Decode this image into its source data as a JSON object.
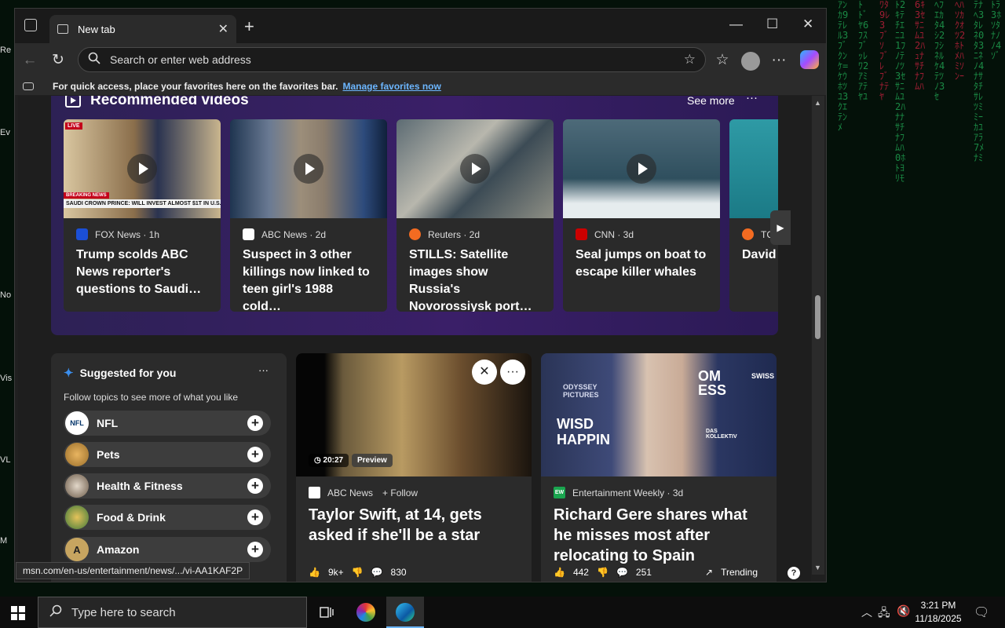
{
  "browser": {
    "tab_title": "New tab",
    "address_placeholder": "Search or enter web address",
    "favbar_text": "For quick access, place your favorites here on the favorites bar.",
    "favbar_link": "Manage favorites now",
    "status_url": "msn.com/en-us/entertainment/news/.../vi-AA1KAF2P"
  },
  "videos": {
    "title": "Recommended videos",
    "see_more": "See more",
    "more": "···",
    "items": [
      {
        "source": "FOX News · 1h",
        "headline": "Trump scolds ABC News reporter's questions to Saudi…",
        "logo_color": "#1b4fd6"
      },
      {
        "source": "ABC News · 2d",
        "headline": "Suspect in 3 other killings now linked to teen girl's 1988 cold…",
        "logo_color": "#ffffff"
      },
      {
        "source": "Reuters · 2d",
        "headline": "STILLS: Satellite images show Russia's Novorossiysk port…",
        "logo_color": "#f36b21"
      },
      {
        "source": "CNN · 3d",
        "headline": "Seal jumps on boat to escape killer whales",
        "logo_color": "#cc0000"
      },
      {
        "source": "TC",
        "headline": "David Why 'I Canno",
        "logo_color": "#f36b21"
      }
    ],
    "thumb_text": {
      "breaking": "BREAKING NEWS",
      "live": "LIVE",
      "ticker": "SAUDI CROWN PRINCE: WILL INVEST ALMOST $1T IN U.S."
    }
  },
  "suggested": {
    "title": "Suggested for you",
    "subtitle": "Follow topics to see more of what you like",
    "more": "···",
    "topics": [
      {
        "label": "NFL",
        "icon": "NFL"
      },
      {
        "label": "Pets",
        "icon": ""
      },
      {
        "label": "Health & Fitness",
        "icon": ""
      },
      {
        "label": "Food & Drink",
        "icon": ""
      },
      {
        "label": "Amazon",
        "icon": "A"
      }
    ]
  },
  "news": [
    {
      "source": "ABC News",
      "follow": "+ Follow",
      "headline": "Taylor Swift, at 14, gets asked if she'll be a star",
      "duration": "20:27",
      "preview": "Preview",
      "likes": "9k+",
      "comments": "830"
    },
    {
      "source": "Entertainment Weekly · 3d",
      "logo": "EW",
      "headline": "Richard Gere shares what he misses most after relocating to Spain",
      "likes": "442",
      "comments": "251",
      "trending": "Trending",
      "image_text": {
        "top_left": "ODYSSEY PICTURES",
        "left": "WISD HAPPIN",
        "top_right": "OM ESS",
        "right": "SWISS",
        "logo": "DAS KOLLEKTIV"
      }
    }
  ],
  "taskbar": {
    "search_placeholder": "Type here to search",
    "time": "3:21 PM",
    "date": "11/18/2025"
  },
  "desktop_labels": [
    "Re",
    "Ev",
    "No",
    "Vis",
    "VL",
    "M"
  ]
}
